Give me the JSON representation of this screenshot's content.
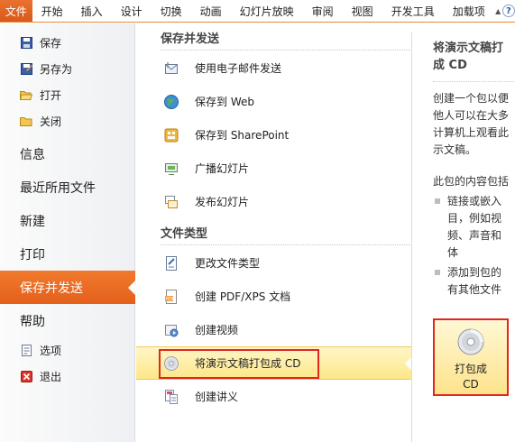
{
  "tabs": {
    "file": "文件",
    "items": [
      "开始",
      "插入",
      "设计",
      "切换",
      "动画",
      "幻灯片放映",
      "审阅",
      "视图",
      "开发工具",
      "加载项"
    ]
  },
  "nav": {
    "save": "保存",
    "save_as": "另存为",
    "open": "打开",
    "close": "关闭",
    "info": "信息",
    "recent": "最近所用文件",
    "new": "新建",
    "print": "打印",
    "save_send": "保存并发送",
    "help": "帮助",
    "options": "选项",
    "exit": "退出"
  },
  "middle": {
    "section1": "保存并发送",
    "section2": "文件类型",
    "email": "使用电子邮件发送",
    "web": "保存到 Web",
    "sharepoint": "保存到 SharePoint",
    "broadcast": "广播幻灯片",
    "publish": "发布幻灯片",
    "change_type": "更改文件类型",
    "pdf": "创建 PDF/XPS 文档",
    "video": "创建视频",
    "package_cd": "将演示文稿打包成 CD",
    "handouts": "创建讲义"
  },
  "right": {
    "title_line1": "将演示文稿打",
    "title_line2": "成 CD",
    "desc": [
      "创建一个包以便",
      "他人可以在大多",
      "计算机上观看此",
      "示文稿。"
    ],
    "contents_label": "此包的内容包括",
    "bullet1": [
      "链接或嵌入",
      "目，例如视",
      "频、声音和",
      "体"
    ],
    "bullet2": [
      "添加到包的",
      "有其他文件"
    ],
    "button_line1": "打包成",
    "button_line2": "CD"
  },
  "colors": {
    "accent_orange": "#e4601c",
    "highlight_red": "#e2261d",
    "selected_yellow": "#fde789"
  }
}
